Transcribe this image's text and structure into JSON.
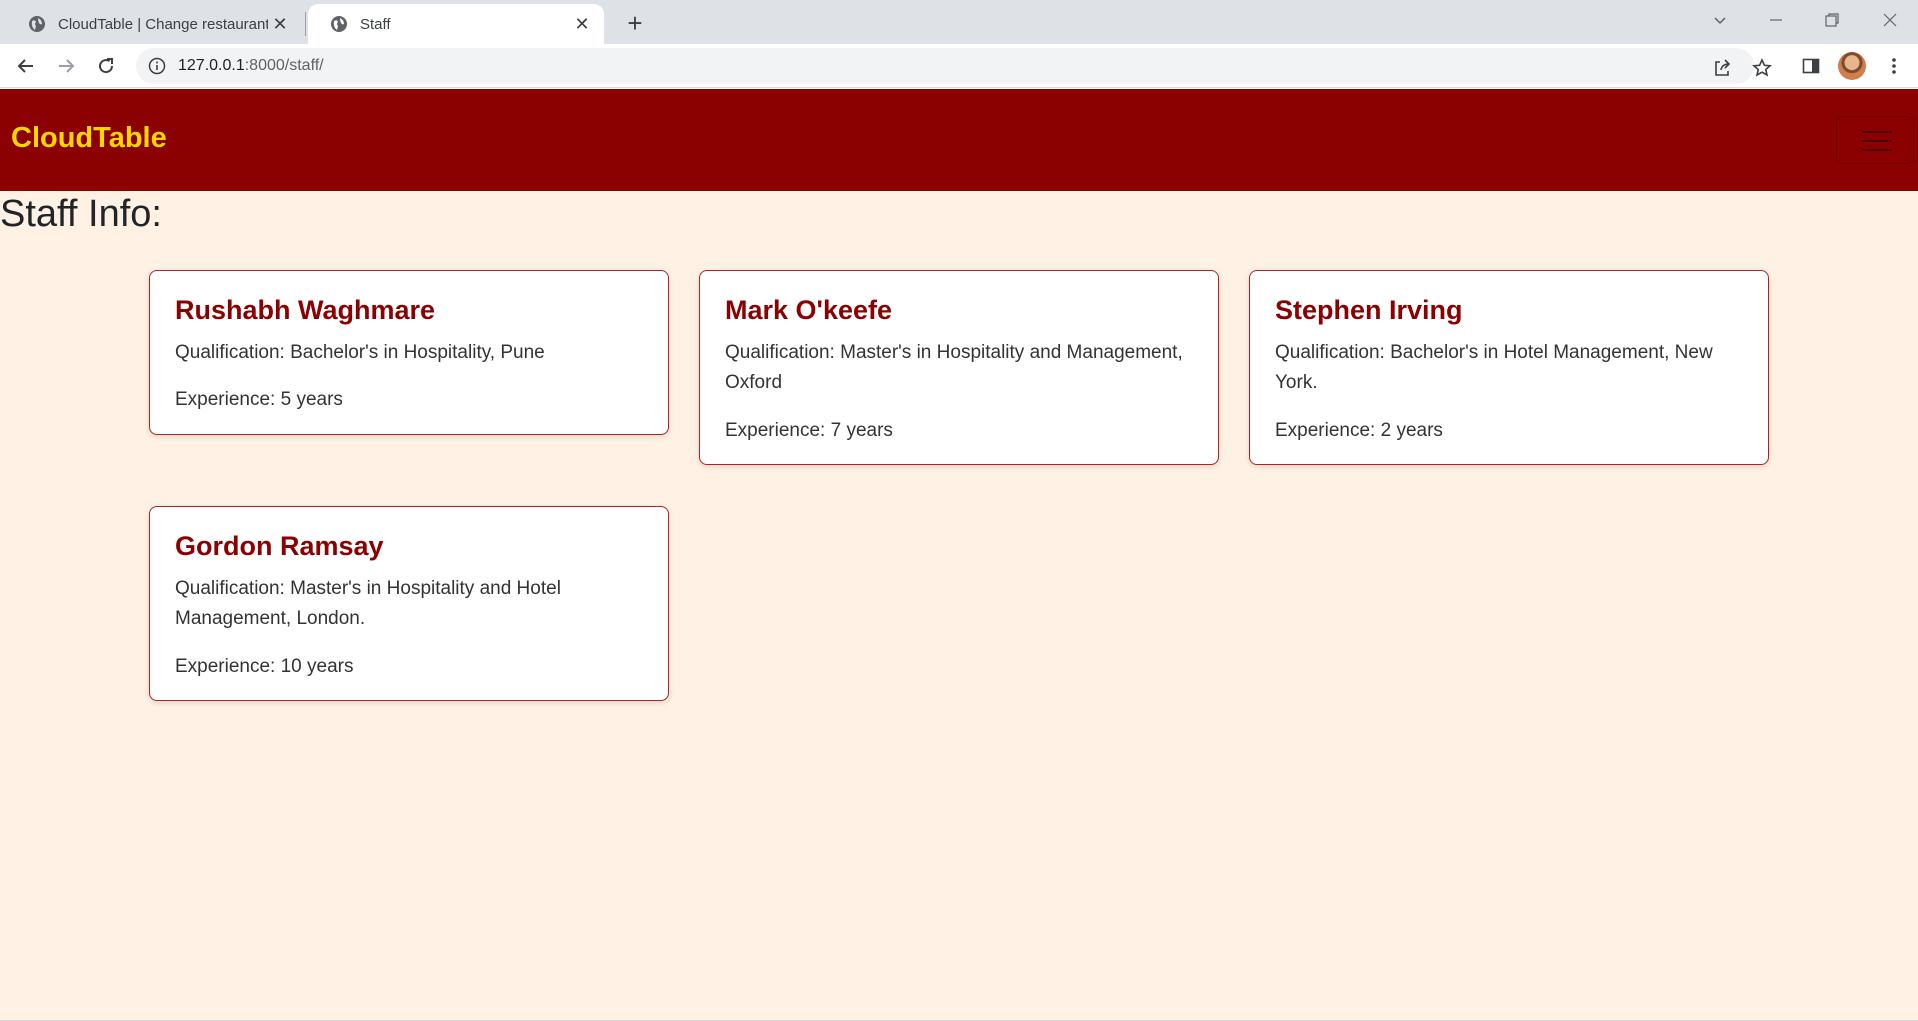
{
  "browser": {
    "tabs": [
      {
        "title": "CloudTable | Change restaurant |",
        "active": false
      },
      {
        "title": "Staff",
        "active": true
      }
    ],
    "url_host": "127.0.0.1",
    "url_path": ":8000/staff/"
  },
  "site": {
    "brand": "CloudTable",
    "heading": "Staff Info:"
  },
  "staff": [
    {
      "name": "Rushabh Waghmare",
      "qualification": "Qualification: Bachelor's in Hospitality, Pune",
      "experience": "Experience: 5 years"
    },
    {
      "name": "Mark O'keefe",
      "qualification": "Qualification: Master's in Hospitality and Management, Oxford",
      "experience": "Experience: 7 years"
    },
    {
      "name": "Stephen Irving",
      "qualification": "Qualification: Bachelor's in Hotel Management, New York.",
      "experience": "Experience: 2 years"
    },
    {
      "name": "Gordon Ramsay",
      "qualification": "Qualification: Master's in Hospitality and Hotel Management, London.",
      "experience": "Experience: 10 years"
    }
  ],
  "colors": {
    "navbar": "#8b0000",
    "brand": "#ffd700",
    "page_background": "#fff1e3",
    "card_title": "#8b0000"
  }
}
